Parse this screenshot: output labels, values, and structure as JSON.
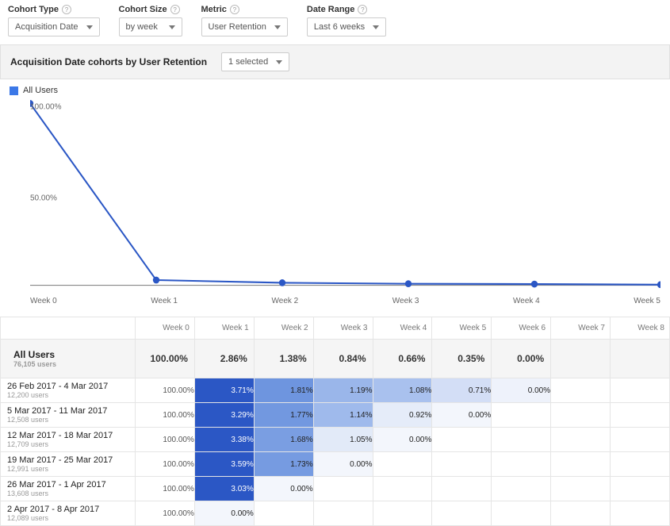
{
  "controls": {
    "cohort_type": {
      "label": "Cohort Type",
      "value": "Acquisition Date"
    },
    "cohort_size": {
      "label": "Cohort Size",
      "value": "by week"
    },
    "metric": {
      "label": "Metric",
      "value": "User Retention"
    },
    "date_range": {
      "label": "Date Range",
      "value": "Last 6 weeks"
    }
  },
  "chart_header": {
    "title": "Acquisition Date cohorts by User Retention",
    "selector_label": "1 selected"
  },
  "legend": {
    "label": "All Users",
    "color": "#3b78e7"
  },
  "chart_data": {
    "type": "line",
    "categories": [
      "Week 0",
      "Week 1",
      "Week 2",
      "Week 3",
      "Week 4",
      "Week 5"
    ],
    "series": [
      {
        "name": "All Users",
        "values": [
          100.0,
          2.86,
          1.38,
          0.84,
          0.66,
          0.35
        ]
      }
    ],
    "title": "",
    "xlabel": "",
    "ylabel": "",
    "ylim": [
      0,
      100
    ],
    "yticks": [
      100.0,
      50.0
    ],
    "legend_position": "top-left",
    "grid": false
  },
  "table": {
    "headers": [
      "",
      "Week 0",
      "Week 1",
      "Week 2",
      "Week 3",
      "Week 4",
      "Week 5",
      "Week 6",
      "Week 7",
      "Week 8"
    ],
    "summary": {
      "label": "All Users",
      "sublabel": "76,105 users",
      "cells": [
        "100.00%",
        "2.86%",
        "1.38%",
        "0.84%",
        "0.66%",
        "0.35%",
        "0.00%",
        "",
        ""
      ]
    },
    "rows": [
      {
        "label": "26 Feb 2017 - 4 Mar 2017",
        "sublabel": "12,200 users",
        "cells": [
          {
            "v": "100.00%",
            "bg": "#ffffff",
            "fg": "#555"
          },
          {
            "v": "3.71%",
            "bg": "#2b57c5",
            "fg": "#fff"
          },
          {
            "v": "1.81%",
            "bg": "#6e95df",
            "fg": "#222"
          },
          {
            "v": "1.19%",
            "bg": "#9ab6ea",
            "fg": "#222"
          },
          {
            "v": "1.08%",
            "bg": "#a9c1ee",
            "fg": "#222"
          },
          {
            "v": "0.71%",
            "bg": "#d3def6",
            "fg": "#222"
          },
          {
            "v": "0.00%",
            "bg": "#eef2fb",
            "fg": "#222"
          },
          null,
          null
        ]
      },
      {
        "label": "5 Mar 2017 - 11 Mar 2017",
        "sublabel": "12,508 users",
        "cells": [
          {
            "v": "100.00%",
            "bg": "#ffffff",
            "fg": "#555"
          },
          {
            "v": "3.29%",
            "bg": "#2b57c5",
            "fg": "#fff"
          },
          {
            "v": "1.77%",
            "bg": "#7298e0",
            "fg": "#222"
          },
          {
            "v": "1.14%",
            "bg": "#9fbaec",
            "fg": "#222"
          },
          {
            "v": "0.92%",
            "bg": "#e5ecf9",
            "fg": "#222"
          },
          {
            "v": "0.00%",
            "bg": "#f3f6fc",
            "fg": "#222"
          },
          null,
          null,
          null
        ]
      },
      {
        "label": "12 Mar 2017 - 18 Mar 2017",
        "sublabel": "12,709 users",
        "cells": [
          {
            "v": "100.00%",
            "bg": "#ffffff",
            "fg": "#555"
          },
          {
            "v": "3.38%",
            "bg": "#2b57c5",
            "fg": "#fff"
          },
          {
            "v": "1.68%",
            "bg": "#7a9ee2",
            "fg": "#222"
          },
          {
            "v": "1.05%",
            "bg": "#e2eaf8",
            "fg": "#222"
          },
          {
            "v": "0.00%",
            "bg": "#f3f6fc",
            "fg": "#222"
          },
          null,
          null,
          null,
          null
        ]
      },
      {
        "label": "19 Mar 2017 - 25 Mar 2017",
        "sublabel": "12,991 users",
        "cells": [
          {
            "v": "100.00%",
            "bg": "#ffffff",
            "fg": "#555"
          },
          {
            "v": "3.59%",
            "bg": "#2b57c5",
            "fg": "#fff"
          },
          {
            "v": "1.73%",
            "bg": "#769be1",
            "fg": "#222"
          },
          {
            "v": "0.00%",
            "bg": "#f3f6fc",
            "fg": "#222"
          },
          null,
          null,
          null,
          null,
          null
        ]
      },
      {
        "label": "26 Mar 2017 - 1 Apr 2017",
        "sublabel": "13,608 users",
        "cells": [
          {
            "v": "100.00%",
            "bg": "#ffffff",
            "fg": "#555"
          },
          {
            "v": "3.03%",
            "bg": "#2b57c5",
            "fg": "#fff"
          },
          {
            "v": "0.00%",
            "bg": "#f3f6fc",
            "fg": "#222"
          },
          null,
          null,
          null,
          null,
          null,
          null
        ]
      },
      {
        "label": "2 Apr 2017 - 8 Apr 2017",
        "sublabel": "12,089 users",
        "cells": [
          {
            "v": "100.00%",
            "bg": "#ffffff",
            "fg": "#555"
          },
          {
            "v": "0.00%",
            "bg": "#f3f6fc",
            "fg": "#222"
          },
          null,
          null,
          null,
          null,
          null,
          null,
          null
        ]
      }
    ]
  }
}
